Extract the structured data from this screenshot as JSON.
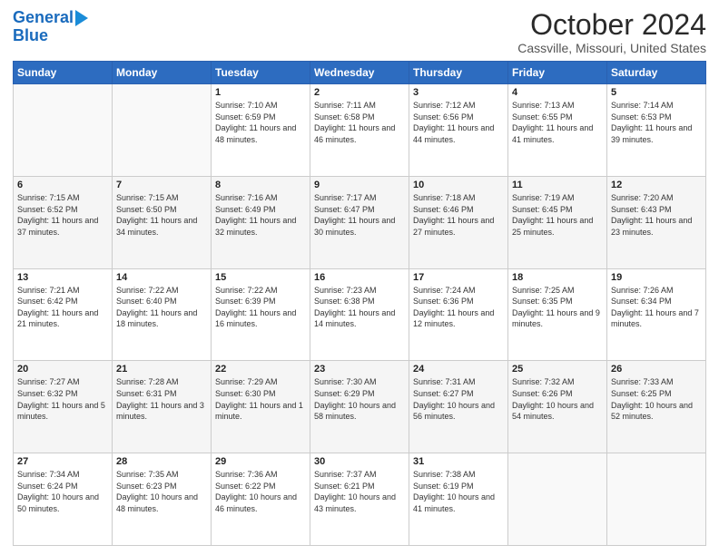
{
  "logo": {
    "line1": "General",
    "line2": "Blue"
  },
  "header": {
    "month": "October 2024",
    "location": "Cassville, Missouri, United States"
  },
  "weekdays": [
    "Sunday",
    "Monday",
    "Tuesday",
    "Wednesday",
    "Thursday",
    "Friday",
    "Saturday"
  ],
  "weeks": [
    [
      {
        "day": "",
        "info": ""
      },
      {
        "day": "",
        "info": ""
      },
      {
        "day": "1",
        "info": "Sunrise: 7:10 AM\nSunset: 6:59 PM\nDaylight: 11 hours and 48 minutes."
      },
      {
        "day": "2",
        "info": "Sunrise: 7:11 AM\nSunset: 6:58 PM\nDaylight: 11 hours and 46 minutes."
      },
      {
        "day": "3",
        "info": "Sunrise: 7:12 AM\nSunset: 6:56 PM\nDaylight: 11 hours and 44 minutes."
      },
      {
        "day": "4",
        "info": "Sunrise: 7:13 AM\nSunset: 6:55 PM\nDaylight: 11 hours and 41 minutes."
      },
      {
        "day": "5",
        "info": "Sunrise: 7:14 AM\nSunset: 6:53 PM\nDaylight: 11 hours and 39 minutes."
      }
    ],
    [
      {
        "day": "6",
        "info": "Sunrise: 7:15 AM\nSunset: 6:52 PM\nDaylight: 11 hours and 37 minutes."
      },
      {
        "day": "7",
        "info": "Sunrise: 7:15 AM\nSunset: 6:50 PM\nDaylight: 11 hours and 34 minutes."
      },
      {
        "day": "8",
        "info": "Sunrise: 7:16 AM\nSunset: 6:49 PM\nDaylight: 11 hours and 32 minutes."
      },
      {
        "day": "9",
        "info": "Sunrise: 7:17 AM\nSunset: 6:47 PM\nDaylight: 11 hours and 30 minutes."
      },
      {
        "day": "10",
        "info": "Sunrise: 7:18 AM\nSunset: 6:46 PM\nDaylight: 11 hours and 27 minutes."
      },
      {
        "day": "11",
        "info": "Sunrise: 7:19 AM\nSunset: 6:45 PM\nDaylight: 11 hours and 25 minutes."
      },
      {
        "day": "12",
        "info": "Sunrise: 7:20 AM\nSunset: 6:43 PM\nDaylight: 11 hours and 23 minutes."
      }
    ],
    [
      {
        "day": "13",
        "info": "Sunrise: 7:21 AM\nSunset: 6:42 PM\nDaylight: 11 hours and 21 minutes."
      },
      {
        "day": "14",
        "info": "Sunrise: 7:22 AM\nSunset: 6:40 PM\nDaylight: 11 hours and 18 minutes."
      },
      {
        "day": "15",
        "info": "Sunrise: 7:22 AM\nSunset: 6:39 PM\nDaylight: 11 hours and 16 minutes."
      },
      {
        "day": "16",
        "info": "Sunrise: 7:23 AM\nSunset: 6:38 PM\nDaylight: 11 hours and 14 minutes."
      },
      {
        "day": "17",
        "info": "Sunrise: 7:24 AM\nSunset: 6:36 PM\nDaylight: 11 hours and 12 minutes."
      },
      {
        "day": "18",
        "info": "Sunrise: 7:25 AM\nSunset: 6:35 PM\nDaylight: 11 hours and 9 minutes."
      },
      {
        "day": "19",
        "info": "Sunrise: 7:26 AM\nSunset: 6:34 PM\nDaylight: 11 hours and 7 minutes."
      }
    ],
    [
      {
        "day": "20",
        "info": "Sunrise: 7:27 AM\nSunset: 6:32 PM\nDaylight: 11 hours and 5 minutes."
      },
      {
        "day": "21",
        "info": "Sunrise: 7:28 AM\nSunset: 6:31 PM\nDaylight: 11 hours and 3 minutes."
      },
      {
        "day": "22",
        "info": "Sunrise: 7:29 AM\nSunset: 6:30 PM\nDaylight: 11 hours and 1 minute."
      },
      {
        "day": "23",
        "info": "Sunrise: 7:30 AM\nSunset: 6:29 PM\nDaylight: 10 hours and 58 minutes."
      },
      {
        "day": "24",
        "info": "Sunrise: 7:31 AM\nSunset: 6:27 PM\nDaylight: 10 hours and 56 minutes."
      },
      {
        "day": "25",
        "info": "Sunrise: 7:32 AM\nSunset: 6:26 PM\nDaylight: 10 hours and 54 minutes."
      },
      {
        "day": "26",
        "info": "Sunrise: 7:33 AM\nSunset: 6:25 PM\nDaylight: 10 hours and 52 minutes."
      }
    ],
    [
      {
        "day": "27",
        "info": "Sunrise: 7:34 AM\nSunset: 6:24 PM\nDaylight: 10 hours and 50 minutes."
      },
      {
        "day": "28",
        "info": "Sunrise: 7:35 AM\nSunset: 6:23 PM\nDaylight: 10 hours and 48 minutes."
      },
      {
        "day": "29",
        "info": "Sunrise: 7:36 AM\nSunset: 6:22 PM\nDaylight: 10 hours and 46 minutes."
      },
      {
        "day": "30",
        "info": "Sunrise: 7:37 AM\nSunset: 6:21 PM\nDaylight: 10 hours and 43 minutes."
      },
      {
        "day": "31",
        "info": "Sunrise: 7:38 AM\nSunset: 6:19 PM\nDaylight: 10 hours and 41 minutes."
      },
      {
        "day": "",
        "info": ""
      },
      {
        "day": "",
        "info": ""
      }
    ]
  ]
}
